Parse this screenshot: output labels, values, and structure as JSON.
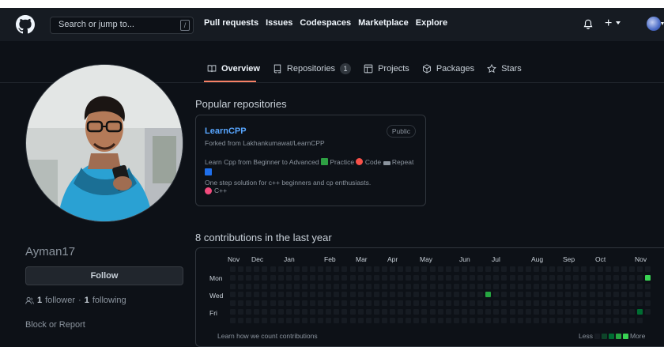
{
  "header": {
    "search_placeholder": "Search or jump to...",
    "search_shortcut": "/",
    "nav": [
      "Pull requests",
      "Issues",
      "Codespaces",
      "Marketplace",
      "Explore"
    ],
    "plus": "+"
  },
  "tabs": [
    {
      "label": "Overview",
      "icon": "book-icon",
      "active": true
    },
    {
      "label": "Repositories",
      "icon": "repo-icon",
      "count": "1"
    },
    {
      "label": "Projects",
      "icon": "table-icon"
    },
    {
      "label": "Packages",
      "icon": "package-icon"
    },
    {
      "label": "Stars",
      "icon": "star-icon"
    }
  ],
  "profile": {
    "username": "Ayman17",
    "follow_label": "Follow",
    "followers_count": "1",
    "followers_label": "follower",
    "separator": "·",
    "following_count": "1",
    "following_label": "following",
    "block_label": "Block or Report"
  },
  "popular": {
    "title": "Popular repositories",
    "repos": [
      {
        "name": "LearnCPP",
        "visibility": "Public",
        "forked_from": "Forked from Lakhankumawat/LearnCPP",
        "desc_1": "Learn Cpp from Beginner to Advanced",
        "desc_2": "Practice",
        "desc_3": "Code",
        "desc_4": "Repeat",
        "desc_5": "One step solution for c++ beginners and cp enthusiasts.",
        "language": "C++",
        "language_color": "#f34b7d"
      }
    ]
  },
  "contributions": {
    "title": "8 contributions in the last year",
    "months": [
      "Nov",
      "Dec",
      "Jan",
      "Feb",
      "Mar",
      "Apr",
      "May",
      "Jun",
      "Jul",
      "Aug",
      "Sep",
      "Oct",
      "Nov"
    ],
    "days": [
      "Mon",
      "Wed",
      "Fri"
    ],
    "learn_link": "Learn how we count contributions",
    "legend_less": "Less",
    "legend_more": "More",
    "colors": {
      "empty": "#161b22",
      "l1": "#0e4429",
      "l2": "#006d32",
      "l3": "#26a641",
      "l4": "#39d353"
    }
  }
}
